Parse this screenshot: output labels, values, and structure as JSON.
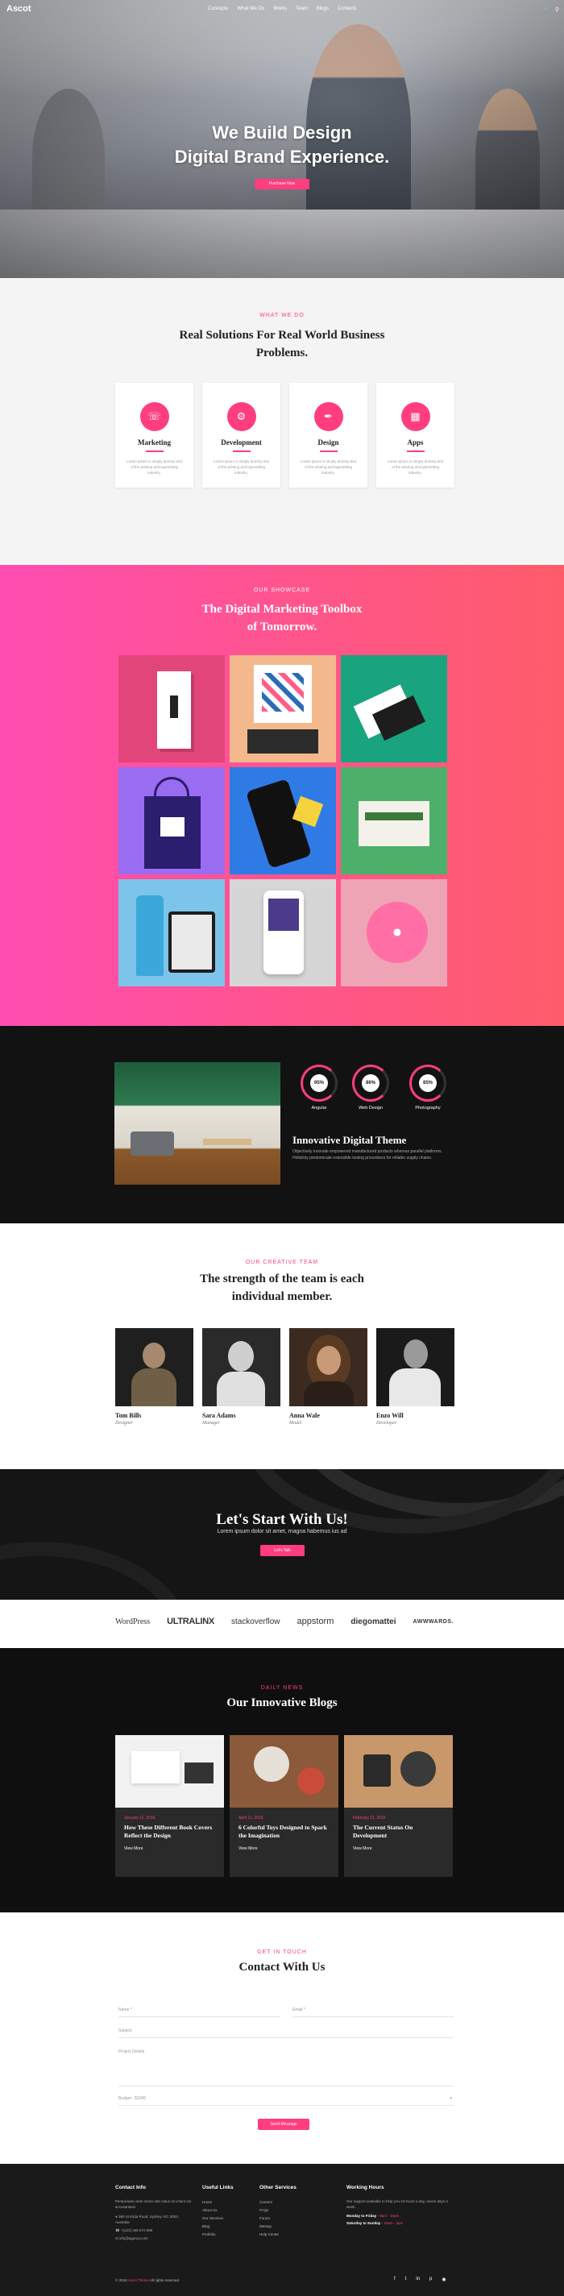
{
  "nav": {
    "logo": "Ascot",
    "menu": [
      "Concepts",
      "What We Do",
      "Works",
      "Team",
      "Blogs",
      "Contacts"
    ],
    "icons": [
      "cart-icon",
      "search-icon"
    ]
  },
  "hero": {
    "line1": "We Build Design",
    "line2": "Digital Brand Experience.",
    "button": "Purchase Now"
  },
  "services": {
    "kicker": "What We Do",
    "title_line1": "Real Solutions For Real World Business",
    "title_line2": "Problems.",
    "items": [
      {
        "title": "Marketing",
        "icon": "headset-icon",
        "desc": "Lorem ipsum is simply dummy text of the printing and typesetting industry."
      },
      {
        "title": "Development",
        "icon": "gear-icon",
        "desc": "Lorem ipsum is simply dummy text of the printing and typesetting industry."
      },
      {
        "title": "Design",
        "icon": "pen-icon",
        "desc": "Lorem ipsum is simply dummy text of the printing and typesetting industry."
      },
      {
        "title": "Apps",
        "icon": "grid-icon",
        "desc": "Lorem ipsum is simply dummy text of the printing and typesetting industry."
      }
    ]
  },
  "showcase": {
    "kicker": "Our Showcase",
    "title_line1": "The Digital Marketing Toolbox",
    "title_line2": "of Tomorrow."
  },
  "theme": {
    "stats": [
      {
        "value": "95%",
        "label": "Angular"
      },
      {
        "value": "86%",
        "label": "Web Design"
      },
      {
        "value": "85%",
        "label": "Photography"
      }
    ],
    "title": "Innovative Digital Theme",
    "desc": "Objectively innovate empowered manufactured products whereas parallel platforms. Holisticly predominate extensible testing procedures for reliable supply chains."
  },
  "team": {
    "kicker": "Our Creative Team",
    "title_line1": "The strength of the team is each",
    "title_line2": "individual member.",
    "members": [
      {
        "name": "Tom Bills",
        "role": "Designer"
      },
      {
        "name": "Sara Adams",
        "role": "Manager"
      },
      {
        "name": "Anna Wale",
        "role": "Model"
      },
      {
        "name": "Enzo Will",
        "role": "Developer"
      }
    ]
  },
  "cta": {
    "title": "Let's Start With Us!",
    "sub": "Lorem ipsum dolor sit amet, magna habemus ius ad",
    "button": "Let's Talk"
  },
  "logos": [
    "WordPress",
    "ULTRALINX",
    "stackoverflow",
    "appstorm",
    "diegomattei",
    "AWWWARDS."
  ],
  "blogs": {
    "kicker": "Daily News",
    "title": "Our Innovative Blogs",
    "posts": [
      {
        "date": "January 11, 2016",
        "title": "How These Different Book Covers Reflect the Design",
        "more": "View More"
      },
      {
        "date": "April 11, 2016",
        "title": "6 Colorful Toys Designed to Spark the Imagination",
        "more": "View More"
      },
      {
        "date": "February 11, 2016",
        "title": "The Current Status On Development",
        "more": "View More"
      }
    ]
  },
  "contact": {
    "kicker": "Get In Touch",
    "title": "Contact With Us",
    "name_ph": "Name *",
    "email_ph": "Email *",
    "subject_ph": "Subject",
    "details_ph": "Project Details",
    "budget_ph": "Budget - $1000",
    "button": "Send Message"
  },
  "footer": {
    "info_head": "Contact Info",
    "info_text": "Perspiciatis unde omnis iste natus sit volunt em accusantium",
    "address": "380 St Kilda Road, Sydney VIC 3004, Australia",
    "phone": "+(123) 345 672 899",
    "mail": "info@agency.com",
    "useful_head": "Useful Links",
    "useful": [
      "Home",
      "About Us",
      "Our Services",
      "Blog",
      "Portfolio"
    ],
    "other_head": "Other Services",
    "other": [
      "Careers",
      "FAQs",
      "Forum",
      "Meetup",
      "Help Center"
    ],
    "hours_head": "Working Hours",
    "hours_text": "Our support available to help you 24 hours a day, seven days a week.",
    "hours1_day": "Monday to Friday",
    "hours1_time": "9am - 10pm",
    "hours2_day": "Saturday to Sunday",
    "hours2_time": "10am - 4pm",
    "copy_pre": "© 2018",
    "copy_brand": "Ascot Theme",
    "copy_post": "All rights reserved",
    "social": [
      "facebook-icon",
      "twitter-icon",
      "linkedin-icon",
      "pinterest-icon",
      "instagram-icon"
    ]
  },
  "colors": {
    "accent": "#ff3d7f",
    "gradient_start": "#ff4db2",
    "gradient_end": "#ff5c6a",
    "dark": "#121212"
  }
}
